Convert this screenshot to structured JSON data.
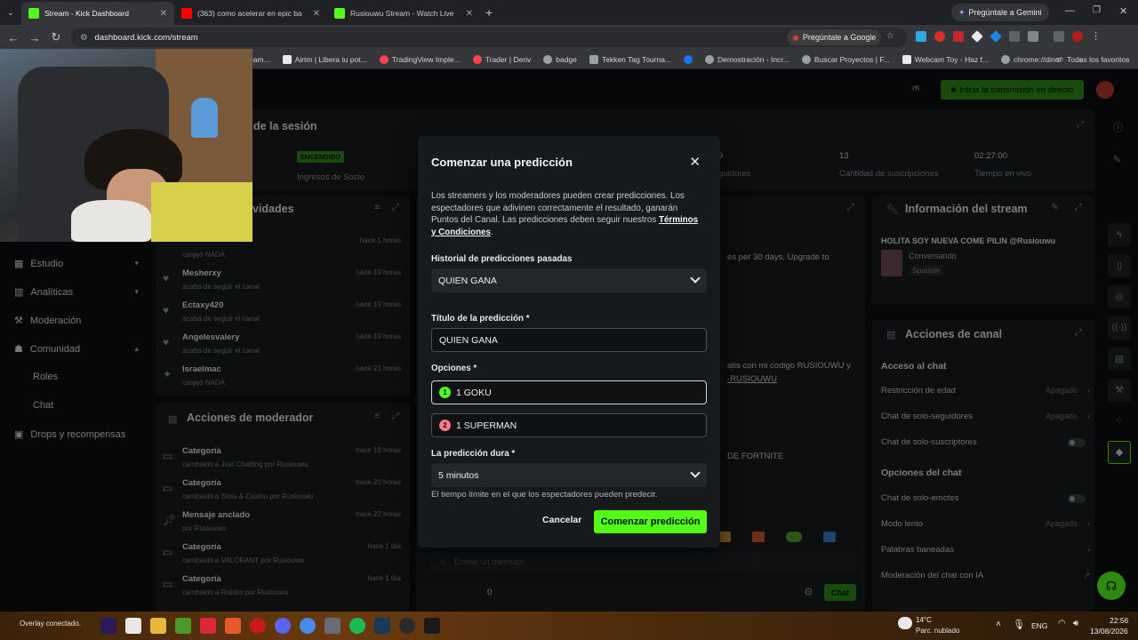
{
  "browser": {
    "tabs": [
      {
        "label": "Stream - Kick Dashboard",
        "active": true,
        "color": "#53fc18"
      },
      {
        "label": "(363) como acelerar en epic ba",
        "active": false,
        "color": "#ff0000"
      },
      {
        "label": "Rusiouwu Stream - Watch Live",
        "active": false,
        "color": "#53fc18"
      }
    ],
    "new_tab": "+",
    "gemini_label": "Pregúntale a Gemini",
    "url": "dashboard.kick.com/stream",
    "ask_google": "Pregúntale a Google",
    "bookmarks": [
      "eam...",
      "Airtm | Libera tu pot...",
      "TradingView Imple...",
      "Trader | Deriv",
      "badge",
      "Tekken Tag Tourna...",
      "",
      "Demostración - Incr...",
      "Buscar Proyectos | F...",
      "Webcam Toy - Haz f...",
      "chrome://dino/"
    ],
    "all_favorites": "Todos los favoritos"
  },
  "header": {
    "go_live": "Inicia la transmisión en directo"
  },
  "sidebar": {
    "items": [
      {
        "label": "Estudio",
        "chevron": "⌄"
      },
      {
        "label": "Analíticas",
        "chevron": "⌄"
      },
      {
        "label": "Moderación",
        "chevron": ""
      },
      {
        "label": "Comunidad",
        "chevron": "⌃"
      },
      {
        "label": "Roles",
        "chevron": ""
      },
      {
        "label": "Chat",
        "chevron": ""
      },
      {
        "label": "Drops y recompensas",
        "chevron": ""
      }
    ]
  },
  "session": {
    "title": "de la sesión",
    "status_badge": "ENCENDIDO",
    "partner_income": "Ingresos de Socio",
    "followers_value": "9",
    "followers_label": "guidores",
    "subs_value": "13",
    "subs_label": "Cantidad de suscripciones",
    "live_value": "02:27:00",
    "live_label": "Tiempo en vivo"
  },
  "activity": {
    "title": "vidades",
    "rows": [
      {
        "name": "",
        "sub": "canjeó NADA",
        "time": "hace 1 horas"
      },
      {
        "name": "Mesherxy",
        "sub": "acaba de seguir el canal",
        "time": "hace 19 horas"
      },
      {
        "name": "Ectaxy420",
        "sub": "acaba de seguir el canal",
        "time": "hace 19 horas"
      },
      {
        "name": "Angelesvalery",
        "sub": "acaba de seguir el canal",
        "time": "hace 19 horas"
      },
      {
        "name": "Israelmac",
        "sub": "canjeó NADA",
        "time": "hace 21 horas"
      }
    ]
  },
  "mod_actions": {
    "title": "Acciones de moderador",
    "rows": [
      {
        "name": "Categoría",
        "sub": "cambiado a Just Chatting por Rusiouwu",
        "time": "hace 19 horas"
      },
      {
        "name": "Categoría",
        "sub": "cambiado a Slots & Casino por Rusiouwu",
        "time": "hace 20 horas"
      },
      {
        "name": "Mensaje anclado",
        "sub": "por Rusiouwu",
        "time": "hace 22 horas"
      },
      {
        "name": "Categoría",
        "sub": "cambiado a VALORANT por Rusiouwu",
        "time": "hace 1 día"
      },
      {
        "name": "Categoría",
        "sub": "cambiado a Roblox por Rusiouwu",
        "time": "hace 1 día"
      }
    ]
  },
  "chat": {
    "snippet1": "es per 30 days. Upgrade to",
    "snippet2": "atis con mi codigo RUSIOUWU y",
    "snippet3": "-RUSIOUWU",
    "snippet4": "DE FORTNITE",
    "placeholder": "Enviar un mensaje",
    "count": "0",
    "send": "Chat"
  },
  "stream_info": {
    "title": "Información del stream",
    "stream_title": "HOLITA SOY NUEVA COME PILIN @Rusiouwu",
    "category": "Conversando",
    "language": "Spanish"
  },
  "channel_actions": {
    "title": "Acciones de canal",
    "section1": "Acceso al chat",
    "items1": [
      {
        "label": "Restricción de edad",
        "value": "Apagado"
      },
      {
        "label": "Chat de solo-seguidores",
        "value": "Apagado"
      },
      {
        "label": "Chat de solo-suscriptores",
        "value": ""
      }
    ],
    "section2": "Opciones del chat",
    "items2": [
      {
        "label": "Chat de solo-emotes",
        "value": ""
      },
      {
        "label": "Modo lento",
        "value": "Apagado"
      },
      {
        "label": "Palabras baneadas",
        "value": ""
      },
      {
        "label": "Moderación del chat con IA",
        "value": ""
      }
    ]
  },
  "modal": {
    "title": "Comenzar una predicción",
    "close": "✕",
    "description": "Los streamers y los moderadores pueden crear predicciones. Los espectadores que adivinen correctamente el resultado, ganarán Puntos del Canal. Las predicciones deben seguir nuestros",
    "terms_link": "Términos y Condiciones",
    "period": ".",
    "history_label": "Historial de predicciones pasadas",
    "history_value": "QUIEN GANA",
    "title_label": "Título de la predicción *",
    "title_value": "QUIEN GANA",
    "options_label": "Opciones *",
    "option1_num": "1",
    "option1_value": "1 GOKU",
    "option2_num": "2",
    "option2_value": "1 SUPERMAN",
    "duration_label": "La predicción dura *",
    "duration_value": "5 minutos",
    "duration_hint": "El tiempo límite en el que los espectadores pueden predecir.",
    "cancel": "Cancelar",
    "submit": "Comenzar predicción"
  },
  "webcam": {
    "overlay_text": "Overlay conectado."
  },
  "taskbar": {
    "weather_temp": "14°C",
    "weather_desc": "Parc. nublado",
    "lang": "ENG",
    "time": "22:56",
    "date": "13/08/2026"
  },
  "colors": {
    "kick_green": "#53fc18",
    "option1": "#53fc18",
    "option2": "#ff7b8a"
  }
}
